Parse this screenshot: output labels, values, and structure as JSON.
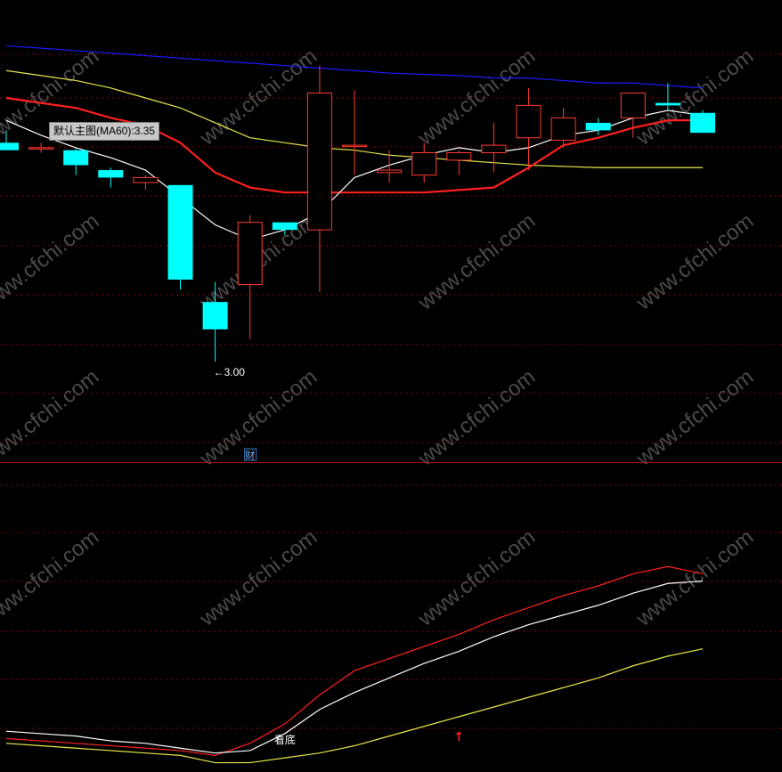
{
  "tooltip": {
    "label": "默认主图(MA60)",
    "value": "3.35"
  },
  "watermark": "www.cfchi.com",
  "colors": {
    "background": "#000000",
    "grid": "#8b0000",
    "up_candle": "#ff3b30",
    "down_candle": "#00ffff",
    "ma60": "#1a1aff",
    "ma_red": "#ff2020",
    "ma_yellow": "#e6e64a",
    "ma_white": "#ffffff",
    "arrow": "#ff2020",
    "watermark": "#4a4a4a"
  },
  "chart_data": [
    {
      "type": "candlestick",
      "panel": "main",
      "ylim": [
        2.6,
        4.4
      ],
      "candles": [
        {
          "o": 3.88,
          "h": 3.93,
          "l": 3.85,
          "c": 3.85
        },
        {
          "o": 3.86,
          "h": 3.88,
          "l": 3.84,
          "c": 3.86
        },
        {
          "o": 3.85,
          "h": 3.86,
          "l": 3.75,
          "c": 3.79
        },
        {
          "o": 3.77,
          "h": 3.78,
          "l": 3.7,
          "c": 3.74
        },
        {
          "o": 3.72,
          "h": 3.75,
          "l": 3.69,
          "c": 3.74
        },
        {
          "o": 3.71,
          "h": 3.71,
          "l": 3.29,
          "c": 3.33
        },
        {
          "o": 3.24,
          "h": 3.32,
          "l": 3.0,
          "c": 3.13
        },
        {
          "o": 3.31,
          "h": 3.59,
          "l": 3.09,
          "c": 3.56
        },
        {
          "o": 3.56,
          "h": 3.56,
          "l": 3.51,
          "c": 3.53
        },
        {
          "o": 3.53,
          "h": 4.19,
          "l": 3.28,
          "c": 4.08
        },
        {
          "o": 3.87,
          "h": 4.09,
          "l": 3.75,
          "c": 3.87
        },
        {
          "o": 3.76,
          "h": 3.85,
          "l": 3.72,
          "c": 3.77
        },
        {
          "o": 3.75,
          "h": 3.88,
          "l": 3.72,
          "c": 3.84
        },
        {
          "o": 3.81,
          "h": 3.85,
          "l": 3.75,
          "c": 3.84
        },
        {
          "o": 3.84,
          "h": 3.96,
          "l": 3.76,
          "c": 3.87
        },
        {
          "o": 3.9,
          "h": 4.1,
          "l": 3.77,
          "c": 4.03
        },
        {
          "o": 3.89,
          "h": 4.02,
          "l": 3.86,
          "c": 3.98
        },
        {
          "o": 3.96,
          "h": 3.98,
          "l": 3.91,
          "c": 3.93
        },
        {
          "o": 3.98,
          "h": 4.07,
          "l": 3.9,
          "c": 4.08
        },
        {
          "o": 4.04,
          "h": 4.12,
          "l": 4.01,
          "c": 4.03
        },
        {
          "o": 4.0,
          "h": 4.01,
          "l": 3.93,
          "c": 3.92
        }
      ],
      "series": [
        {
          "color": "#1a1aff",
          "values": [
            4.27,
            4.26,
            4.25,
            4.24,
            4.23,
            4.22,
            4.21,
            4.2,
            4.19,
            4.18,
            4.17,
            4.16,
            4.155,
            4.15,
            4.14,
            4.14,
            4.13,
            4.12,
            4.12,
            4.11,
            4.1
          ]
        },
        {
          "color": "#e6e64a",
          "values": [
            4.17,
            4.15,
            4.13,
            4.1,
            4.06,
            4.02,
            3.96,
            3.9,
            3.88,
            3.86,
            3.85,
            3.83,
            3.82,
            3.81,
            3.8,
            3.79,
            3.785,
            3.78,
            3.78,
            3.78,
            3.78
          ]
        },
        {
          "color": "#ff2020",
          "values": [
            4.06,
            4.04,
            4.02,
            3.98,
            3.95,
            3.88,
            3.76,
            3.7,
            3.68,
            3.68,
            3.68,
            3.68,
            3.68,
            3.69,
            3.7,
            3.78,
            3.87,
            3.9,
            3.94,
            3.97,
            3.97
          ]
        },
        {
          "color": "#ffffff",
          "values": [
            3.97,
            3.91,
            3.86,
            3.82,
            3.77,
            3.66,
            3.55,
            3.49,
            3.53,
            3.6,
            3.74,
            3.79,
            3.83,
            3.86,
            3.84,
            3.86,
            3.91,
            3.93,
            3.98,
            4.01,
            3.99
          ]
        }
      ],
      "annotations": [
        {
          "text": "←3.00",
          "index": 6,
          "value": 3.0
        },
        {
          "text": "财",
          "index": 7
        }
      ]
    },
    {
      "type": "line",
      "panel": "indicator",
      "ylim": [
        0,
        100
      ],
      "series": [
        {
          "color": "#ff2020",
          "values": [
            12,
            11,
            10,
            9,
            8,
            7,
            5,
            10,
            18,
            30,
            40,
            45,
            50,
            55,
            61,
            66,
            71,
            75,
            80,
            83,
            80
          ]
        },
        {
          "color": "#ffffff",
          "values": [
            15,
            14,
            13,
            11,
            10,
            8,
            6,
            7,
            14,
            24,
            31,
            37,
            43,
            48,
            54,
            59,
            63,
            67,
            72,
            76,
            77
          ]
        },
        {
          "color": "#e6e64a",
          "values": [
            10,
            9,
            8,
            7,
            6,
            5,
            2,
            2,
            4,
            6,
            9,
            13,
            17,
            21,
            25,
            29,
            33,
            37,
            42,
            46,
            49
          ]
        }
      ],
      "annotations": [
        {
          "text": "看底",
          "index": 8
        },
        {
          "text": "↑",
          "index": 13
        }
      ]
    }
  ]
}
